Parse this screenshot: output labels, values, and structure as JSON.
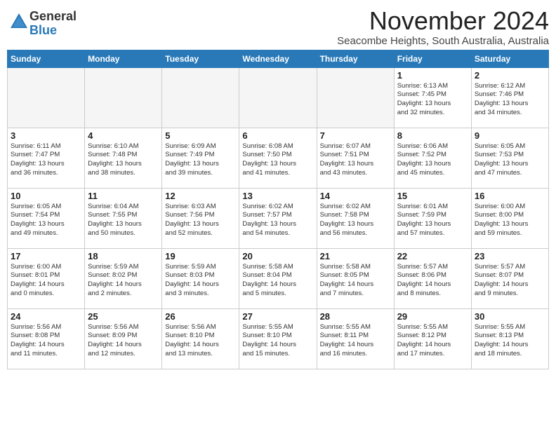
{
  "logo": {
    "general": "General",
    "blue": "Blue"
  },
  "header": {
    "month": "November 2024",
    "location": "Seacombe Heights, South Australia, Australia"
  },
  "weekdays": [
    "Sunday",
    "Monday",
    "Tuesday",
    "Wednesday",
    "Thursday",
    "Friday",
    "Saturday"
  ],
  "weeks": [
    [
      {
        "day": "",
        "info": ""
      },
      {
        "day": "",
        "info": ""
      },
      {
        "day": "",
        "info": ""
      },
      {
        "day": "",
        "info": ""
      },
      {
        "day": "",
        "info": ""
      },
      {
        "day": "1",
        "info": "Sunrise: 6:13 AM\nSunset: 7:45 PM\nDaylight: 13 hours\nand 32 minutes."
      },
      {
        "day": "2",
        "info": "Sunrise: 6:12 AM\nSunset: 7:46 PM\nDaylight: 13 hours\nand 34 minutes."
      }
    ],
    [
      {
        "day": "3",
        "info": "Sunrise: 6:11 AM\nSunset: 7:47 PM\nDaylight: 13 hours\nand 36 minutes."
      },
      {
        "day": "4",
        "info": "Sunrise: 6:10 AM\nSunset: 7:48 PM\nDaylight: 13 hours\nand 38 minutes."
      },
      {
        "day": "5",
        "info": "Sunrise: 6:09 AM\nSunset: 7:49 PM\nDaylight: 13 hours\nand 39 minutes."
      },
      {
        "day": "6",
        "info": "Sunrise: 6:08 AM\nSunset: 7:50 PM\nDaylight: 13 hours\nand 41 minutes."
      },
      {
        "day": "7",
        "info": "Sunrise: 6:07 AM\nSunset: 7:51 PM\nDaylight: 13 hours\nand 43 minutes."
      },
      {
        "day": "8",
        "info": "Sunrise: 6:06 AM\nSunset: 7:52 PM\nDaylight: 13 hours\nand 45 minutes."
      },
      {
        "day": "9",
        "info": "Sunrise: 6:05 AM\nSunset: 7:53 PM\nDaylight: 13 hours\nand 47 minutes."
      }
    ],
    [
      {
        "day": "10",
        "info": "Sunrise: 6:05 AM\nSunset: 7:54 PM\nDaylight: 13 hours\nand 49 minutes."
      },
      {
        "day": "11",
        "info": "Sunrise: 6:04 AM\nSunset: 7:55 PM\nDaylight: 13 hours\nand 50 minutes."
      },
      {
        "day": "12",
        "info": "Sunrise: 6:03 AM\nSunset: 7:56 PM\nDaylight: 13 hours\nand 52 minutes."
      },
      {
        "day": "13",
        "info": "Sunrise: 6:02 AM\nSunset: 7:57 PM\nDaylight: 13 hours\nand 54 minutes."
      },
      {
        "day": "14",
        "info": "Sunrise: 6:02 AM\nSunset: 7:58 PM\nDaylight: 13 hours\nand 56 minutes."
      },
      {
        "day": "15",
        "info": "Sunrise: 6:01 AM\nSunset: 7:59 PM\nDaylight: 13 hours\nand 57 minutes."
      },
      {
        "day": "16",
        "info": "Sunrise: 6:00 AM\nSunset: 8:00 PM\nDaylight: 13 hours\nand 59 minutes."
      }
    ],
    [
      {
        "day": "17",
        "info": "Sunrise: 6:00 AM\nSunset: 8:01 PM\nDaylight: 14 hours\nand 0 minutes."
      },
      {
        "day": "18",
        "info": "Sunrise: 5:59 AM\nSunset: 8:02 PM\nDaylight: 14 hours\nand 2 minutes."
      },
      {
        "day": "19",
        "info": "Sunrise: 5:59 AM\nSunset: 8:03 PM\nDaylight: 14 hours\nand 3 minutes."
      },
      {
        "day": "20",
        "info": "Sunrise: 5:58 AM\nSunset: 8:04 PM\nDaylight: 14 hours\nand 5 minutes."
      },
      {
        "day": "21",
        "info": "Sunrise: 5:58 AM\nSunset: 8:05 PM\nDaylight: 14 hours\nand 7 minutes."
      },
      {
        "day": "22",
        "info": "Sunrise: 5:57 AM\nSunset: 8:06 PM\nDaylight: 14 hours\nand 8 minutes."
      },
      {
        "day": "23",
        "info": "Sunrise: 5:57 AM\nSunset: 8:07 PM\nDaylight: 14 hours\nand 9 minutes."
      }
    ],
    [
      {
        "day": "24",
        "info": "Sunrise: 5:56 AM\nSunset: 8:08 PM\nDaylight: 14 hours\nand 11 minutes."
      },
      {
        "day": "25",
        "info": "Sunrise: 5:56 AM\nSunset: 8:09 PM\nDaylight: 14 hours\nand 12 minutes."
      },
      {
        "day": "26",
        "info": "Sunrise: 5:56 AM\nSunset: 8:10 PM\nDaylight: 14 hours\nand 13 minutes."
      },
      {
        "day": "27",
        "info": "Sunrise: 5:55 AM\nSunset: 8:10 PM\nDaylight: 14 hours\nand 15 minutes."
      },
      {
        "day": "28",
        "info": "Sunrise: 5:55 AM\nSunset: 8:11 PM\nDaylight: 14 hours\nand 16 minutes."
      },
      {
        "day": "29",
        "info": "Sunrise: 5:55 AM\nSunset: 8:12 PM\nDaylight: 14 hours\nand 17 minutes."
      },
      {
        "day": "30",
        "info": "Sunrise: 5:55 AM\nSunset: 8:13 PM\nDaylight: 14 hours\nand 18 minutes."
      }
    ]
  ]
}
